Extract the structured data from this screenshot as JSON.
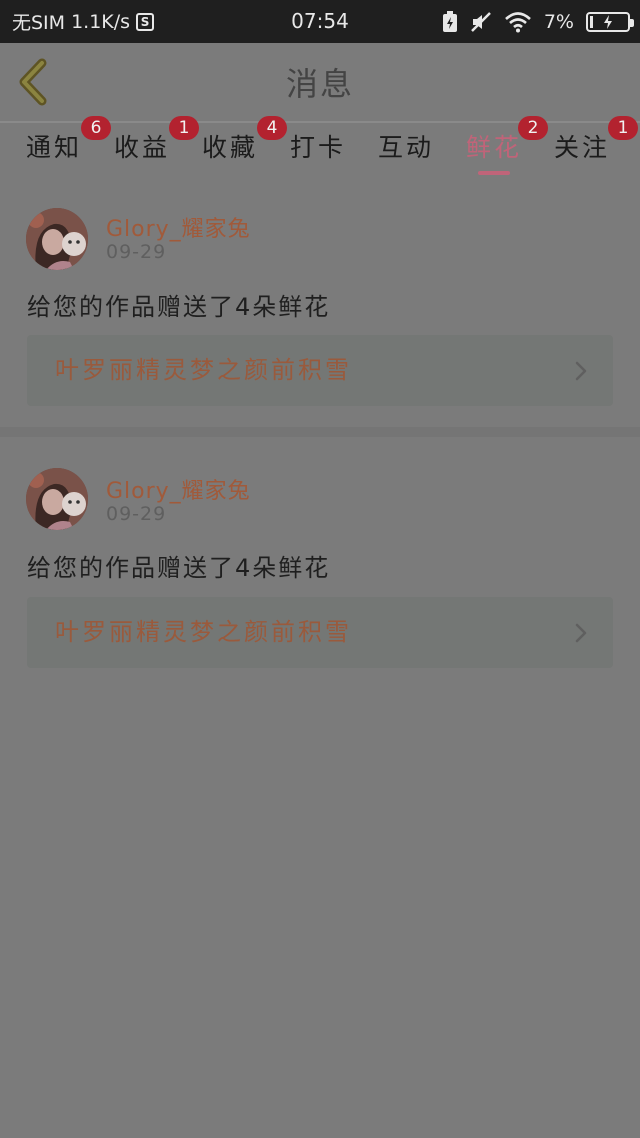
{
  "status_bar": {
    "carrier": "无SIM",
    "speed": "1.1K/s",
    "s_badge": "S",
    "time": "07:54",
    "battery_percent": "7%",
    "icons": [
      "battery-saver-icon",
      "mute-icon",
      "wifi-icon",
      "battery-charging-icon"
    ]
  },
  "header": {
    "title": "消息",
    "back_icon": "chevron-left-icon"
  },
  "tabs": [
    {
      "label": "通知",
      "badge": "6",
      "active": false
    },
    {
      "label": "收益",
      "badge": "1",
      "active": false
    },
    {
      "label": "收藏",
      "badge": "4",
      "active": false
    },
    {
      "label": "打卡",
      "badge": "",
      "active": false
    },
    {
      "label": "互动",
      "badge": "",
      "active": false
    },
    {
      "label": "鲜花",
      "badge": "2",
      "active": true
    },
    {
      "label": "关注",
      "badge": "1",
      "active": false
    }
  ],
  "messages": [
    {
      "username": "Glory_耀家兔",
      "date": "09-29",
      "text": "给您的作品赠送了4朵鲜花",
      "work_title": "叶罗丽精灵梦之颜前积雪"
    },
    {
      "username": "Glory_耀家兔",
      "date": "09-29",
      "text": "给您的作品赠送了4朵鲜花",
      "work_title": "叶罗丽精灵梦之颜前积雪"
    }
  ],
  "colors": {
    "accent": "#c06479",
    "badge": "#b3222f",
    "username": "#a15a3a",
    "overlay_bg": "#7b7b7b"
  }
}
